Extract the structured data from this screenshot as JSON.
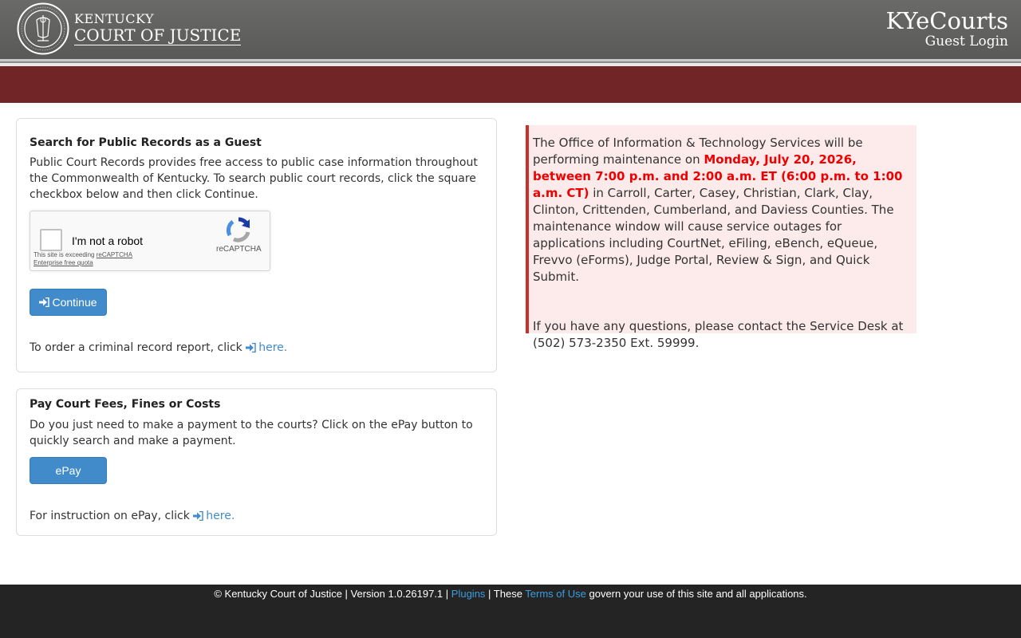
{
  "header": {
    "brand_top": "KENTUCKY",
    "brand_bottom": "COURT OF JUSTICE",
    "app_name": "KYeCourts",
    "page_subtitle": "Guest Login",
    "seal_text": "COMMONWEALTH OF KENTUCKY · COURT OF JUSTICE"
  },
  "search_panel": {
    "title": "Search for Public Records as a Guest",
    "description": "Public Court Records provides free access to public case information throughout the Commonwealth of Kentucky. To search public court records, click the square checkbox below and then click Continue.",
    "captcha": {
      "label": "I'm not a robot",
      "note_prefix": "This site is exceeding ",
      "note_link": "reCAPTCHA",
      "note_suffix": "Enterprise free quota",
      "brand": "reCAPTCHA"
    },
    "continue_label": "Continue",
    "order_text": "To order a criminal record report, click ",
    "order_link": "here."
  },
  "pay_panel": {
    "title": "Pay Court Fees, Fines or Costs",
    "description": "Do you just need to make a payment to the courts? Click on the ePay button to quickly search and make a payment.",
    "epay_label": "ePay",
    "instruction_text": "For instruction on ePay, click ",
    "instruction_link": "here."
  },
  "alert": {
    "text_before": "The Office of Information & Technology Services will be performing maintenance on ",
    "highlight": "Monday, July 20, 2026, between 7:00 p.m. and 2:00 a.m. ET (6:00 p.m. to 1:00 a.m. CT)",
    "text_after": " in Carroll, Carter, Casey, Christian, Clark, Clay, Clinton, Crittenden, Cumberland, and Daviess Counties. The maintenance window will cause service outages for applications including CourtNet, eFiling, eBench, eQueue, Frevvo (eForms), Judge Portal, Review & Sign, and Quick Submit.",
    "contact": "If you have any questions, please contact the Service Desk at (502) 573-2350 Ext. 59999."
  },
  "footer": {
    "copyright": "© Kentucky Court of Justice | Version 1.0.26197.1 | ",
    "plugins_link": "Plugins",
    "sep": " | These ",
    "terms_link": "Terms of Use",
    "tail": " govern your use of this site and all applications."
  },
  "colors": {
    "header_bg": "#5f5f5e",
    "band": "#722527",
    "primary": "#428bca",
    "alert_border": "#c9302c",
    "alert_highlight": "#e00000",
    "footer_bg": "#242424"
  }
}
